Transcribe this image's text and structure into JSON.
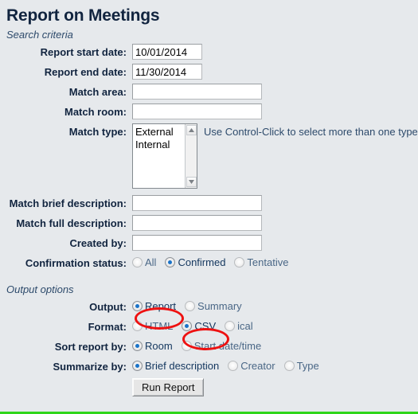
{
  "page": {
    "title": "Report on Meetings",
    "search_legend": "Search criteria",
    "output_legend": "Output options",
    "accent_green": "#2fd61a",
    "annotation_color": "#ee1111",
    "background": "#e6e9ec"
  },
  "fields": {
    "report_start_date": {
      "label": "Report start date:",
      "value": "10/01/2014"
    },
    "report_end_date": {
      "label": "Report end date:",
      "value": "11/30/2014"
    },
    "match_area": {
      "label": "Match area:",
      "value": ""
    },
    "match_room": {
      "label": "Match room:",
      "value": ""
    },
    "match_type": {
      "label": "Match type:",
      "options": [
        "External",
        "Internal"
      ],
      "hint": "Use Control-Click to select more than one type"
    },
    "match_brief_description": {
      "label": "Match brief description:",
      "value": ""
    },
    "match_full_description": {
      "label": "Match full description:",
      "value": ""
    },
    "created_by": {
      "label": "Created by:",
      "value": ""
    },
    "confirmation_status": {
      "label": "Confirmation status:",
      "options": [
        {
          "label": "All",
          "selected": false
        },
        {
          "label": "Confirmed",
          "selected": true
        },
        {
          "label": "Tentative",
          "selected": false
        }
      ]
    }
  },
  "output_options": {
    "output": {
      "label": "Output:",
      "options": [
        {
          "label": "Report",
          "selected": true,
          "annotated": true
        },
        {
          "label": "Summary",
          "selected": false,
          "annotated": false
        }
      ]
    },
    "format": {
      "label": "Format:",
      "options": [
        {
          "label": "HTML",
          "selected": false,
          "annotated": false
        },
        {
          "label": "CSV",
          "selected": true,
          "annotated": true
        },
        {
          "label": "ical",
          "selected": false,
          "annotated": false
        }
      ]
    },
    "sort_report_by": {
      "label": "Sort report by:",
      "options": [
        {
          "label": "Room",
          "selected": true
        },
        {
          "label": "Start date/time",
          "selected": false
        }
      ]
    },
    "summarize_by": {
      "label": "Summarize by:",
      "options": [
        {
          "label": "Brief description",
          "selected": true
        },
        {
          "label": "Creator",
          "selected": false
        },
        {
          "label": "Type",
          "selected": false
        }
      ]
    },
    "submit": {
      "label": "Run Report"
    }
  }
}
